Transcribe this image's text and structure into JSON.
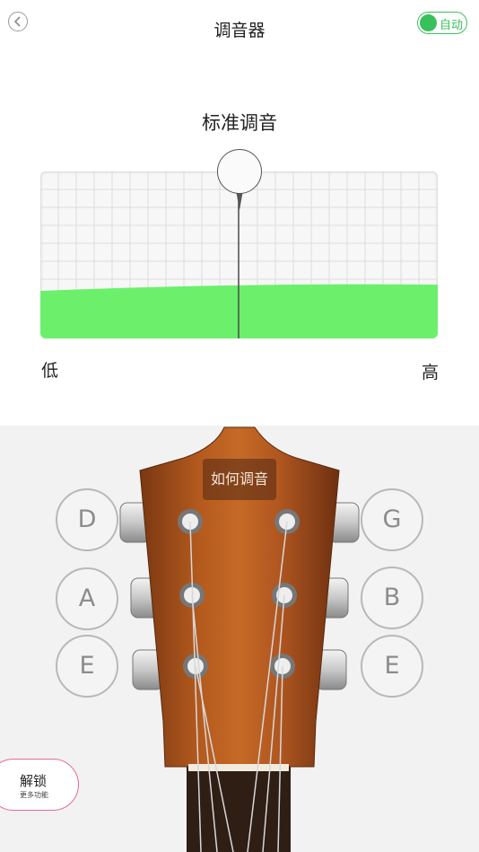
{
  "header": {
    "title": "调音器",
    "auto_label": "自动",
    "auto_enabled": true
  },
  "tuning": {
    "mode": "标准调音",
    "low_label": "低",
    "high_label": "高"
  },
  "guitar": {
    "help_label": "如何调音",
    "left_strings": [
      "D",
      "A",
      "E"
    ],
    "right_strings": [
      "G",
      "B",
      "E"
    ]
  },
  "unlock": {
    "title": "解锁",
    "subtitle": "更多功能"
  },
  "colors": {
    "accent_green": "#38c05a",
    "meter_fill": "#6cf06c",
    "unlock_border": "#e56b9a"
  },
  "icons": {
    "back": "chevron-left-circle-icon"
  }
}
